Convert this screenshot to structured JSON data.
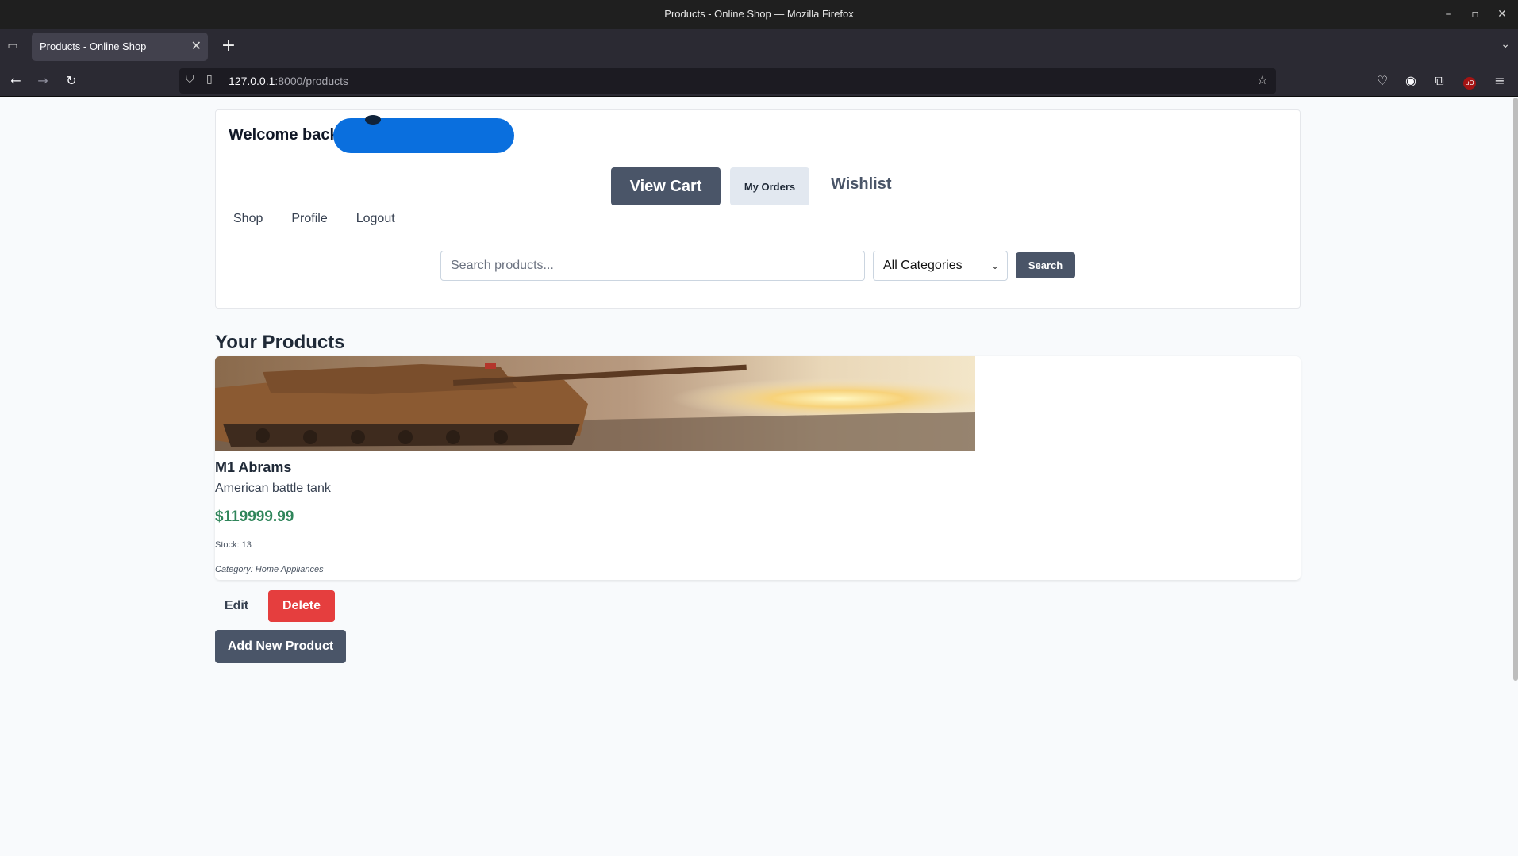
{
  "window": {
    "title": "Products - Online Shop — Mozilla Firefox",
    "controls": {
      "minimize": "–",
      "maximize": "▫",
      "close": "✕"
    }
  },
  "tabs": [
    {
      "label": "Products - Online Shop",
      "close": "✕"
    }
  ],
  "toolbar": {
    "url_host": "127.0.0.1",
    "url_path": ":8000/products",
    "icons": [
      "back-icon",
      "forward-icon",
      "reload-icon",
      "shield-icon",
      "page-icon",
      "bookmark-star-icon",
      "pocket-icon",
      "account-icon",
      "extensions-icon",
      "ublock-icon",
      "menu-icon"
    ]
  },
  "header": {
    "welcome": "Welcome back",
    "view_cart": "View Cart",
    "my_orders": "My Orders",
    "wishlist": "Wishlist",
    "nav": [
      "Shop",
      "Profile",
      "Logout"
    ]
  },
  "search": {
    "placeholder": "Search products...",
    "value": "",
    "category_selected": "All Categories",
    "button": "Search"
  },
  "products_section": {
    "title": "Your Products",
    "items": [
      {
        "name": "M1 Abrams",
        "description": "American battle tank",
        "price": "$119999.99",
        "stock_label": "Stock:",
        "stock": "13",
        "category_label": "Category:",
        "category": "Home Appliances",
        "edit_label": "Edit",
        "delete_label": "Delete"
      }
    ],
    "add_button": "Add New Product"
  },
  "colors": {
    "primary": "#4a5568",
    "danger": "#e53e3e",
    "price": "#2f855a",
    "redaction": "#0a6fde"
  }
}
